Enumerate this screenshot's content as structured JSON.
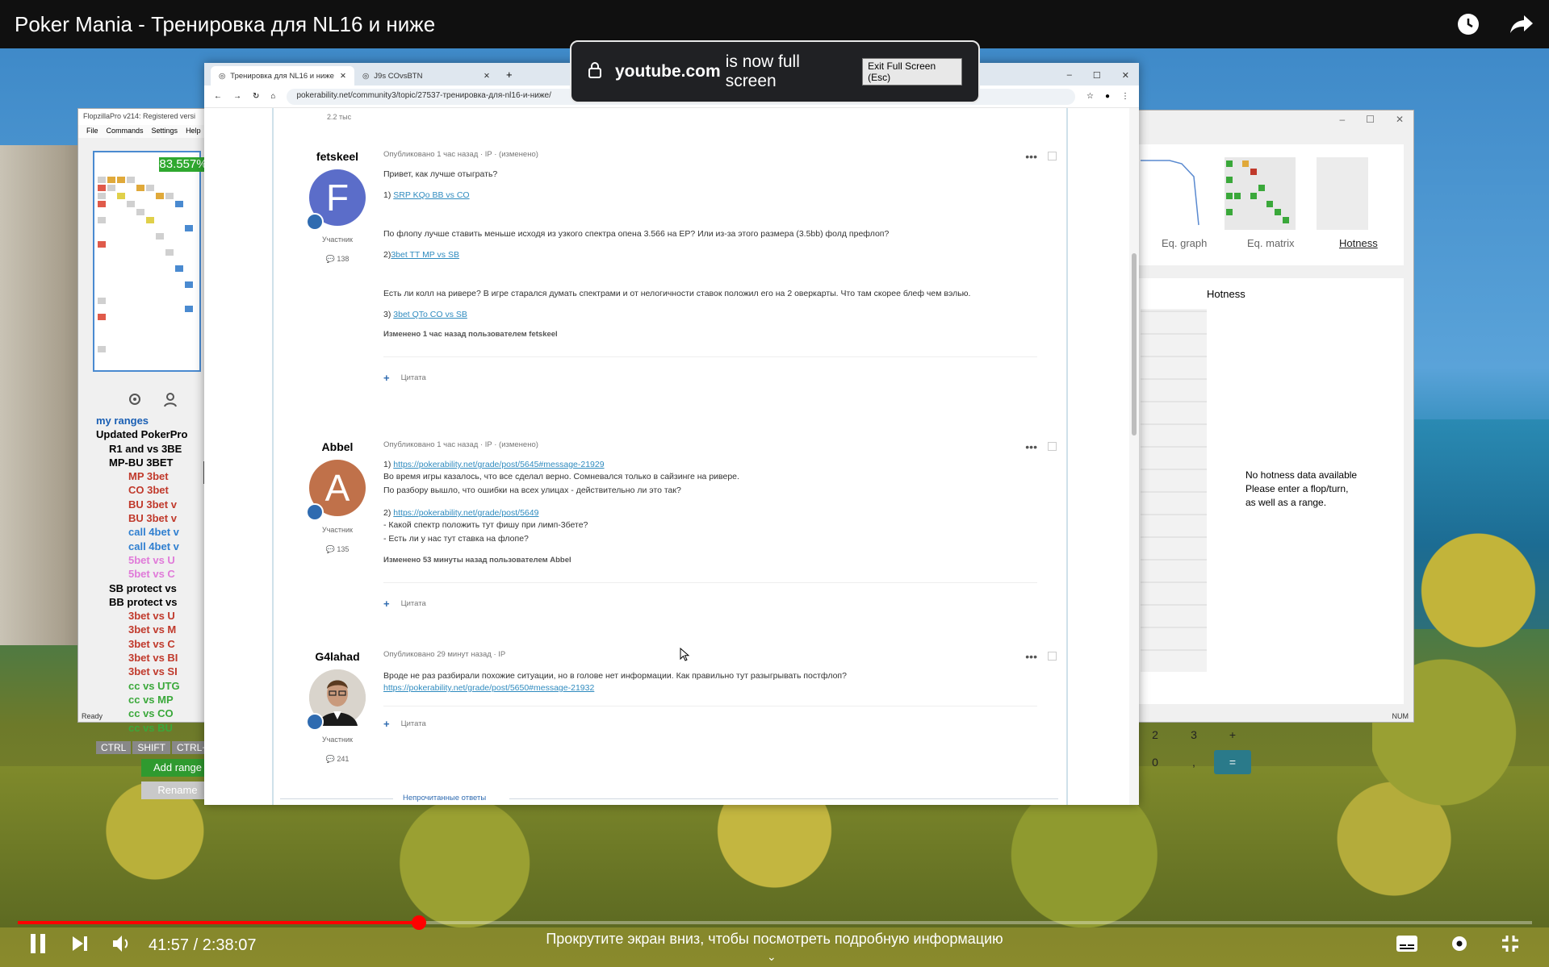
{
  "video": {
    "title": "Poker Mania - Тренировка для NL16 и ниже",
    "time_current": "41:57",
    "time_total": "2:38:07",
    "time_display": "41:57 / 2:38:07",
    "progress_fraction": 0.265,
    "scroll_hint": "Прокрутите экран вниз, чтобы посмотреть подробную информацию"
  },
  "toast": {
    "domain": "youtube.com",
    "message": "is now full screen",
    "exit_label": "Exit Full Screen (Esc)"
  },
  "flopzilla": {
    "title": "FlopzillaPro v214: Registered versi",
    "menu": [
      "File",
      "Commands",
      "Settings",
      "Help"
    ],
    "equity": "83.557%",
    "tree": [
      {
        "label": "my ranges",
        "color": "#1a5fb4"
      },
      {
        "label": "Updated PokerPro",
        "color": "#000"
      },
      {
        "label": "R1 and vs 3BE",
        "color": "#000"
      },
      {
        "label": "MP-BU 3BET",
        "color": "#000"
      },
      {
        "label": "MP 3bet",
        "color": "#c0392b"
      },
      {
        "label": "CO 3bet",
        "color": "#c0392b"
      },
      {
        "label": "BU 3bet v",
        "color": "#c0392b"
      },
      {
        "label": "BU 3bet v",
        "color": "#c0392b"
      },
      {
        "label": "call 4bet v",
        "color": "#2f7fd0"
      },
      {
        "label": "call 4bet v",
        "color": "#2f7fd0"
      },
      {
        "label": "5bet vs U",
        "color": "#e07ad9"
      },
      {
        "label": "5bet vs C",
        "color": "#e07ad9"
      },
      {
        "label": "SB protect vs",
        "color": "#000"
      },
      {
        "label": "BB protect vs",
        "color": "#000"
      },
      {
        "label": "3bet vs U",
        "color": "#c0392b"
      },
      {
        "label": "3bet vs M",
        "color": "#c0392b"
      },
      {
        "label": "3bet vs C",
        "color": "#c0392b"
      },
      {
        "label": "3bet vs BI",
        "color": "#c0392b"
      },
      {
        "label": "3bet vs SI",
        "color": "#c0392b"
      },
      {
        "label": "cc vs UTG",
        "color": "#3aa83a"
      },
      {
        "label": "cc vs MP",
        "color": "#3aa83a"
      },
      {
        "label": "cc vs CO",
        "color": "#3aa83a"
      },
      {
        "label": "cc vs BU",
        "color": "#3aa83a"
      }
    ],
    "keys": [
      "CTRL",
      "SHIFT",
      "CTRL+SH"
    ],
    "add_range": "Add range",
    "rename": "Rename",
    "status": "Ready"
  },
  "flopzilla_right": {
    "tabs": [
      "Eq. graph",
      "Eq. matrix",
      "Hotness"
    ],
    "hotness_title": "Hotness",
    "no_data": [
      "No hotness data available",
      "Please enter a flop/turn,",
      "as well as a range."
    ],
    "num": "NUM"
  },
  "calculator": {
    "keys": [
      "2",
      "3",
      "+",
      "0",
      ",",
      "="
    ]
  },
  "browser": {
    "tabs": [
      {
        "label": "Тренировка для NL16 и ниже"
      },
      {
        "label": "J9s COvsBTN"
      }
    ],
    "url": "pokerability.net/community3/topic/27537-тренировка-для-nl16-и-ниже/",
    "forum": {
      "top_count": "2.2 тыс",
      "posts": [
        {
          "author": "fetskeel",
          "avatar_letter": "F",
          "avatar_color": "#5b6dc9",
          "role": "Участник",
          "count": "138",
          "meta": "Опубликовано 1 час назад · IP · (изменено)",
          "greeting": "Привет, как лучше отыграть?",
          "link1_prefix": "1) ",
          "link1": "SRP KQo BB vs CO",
          "text1": "По флопу лучше ставить меньше исходя из узкого спектра опена 3.566 на EP? Или из-за этого размера (3.5bb) фолд префлоп?",
          "link2_prefix": "2)",
          "link2": "3bet TT MP vs SB",
          "text2": "Есть ли колл на ривере? В игре старался думать спектрами и от нелогичности ставок положил его на 2 оверкарты. Что там скорее блеф чем вэлью.",
          "link3_prefix": "3) ",
          "link3": "3bet QTo CO vs SB",
          "edited": "Изменено 1 час назад пользователем fetskeel",
          "quote": "Цитата"
        },
        {
          "author": "Abbel",
          "avatar_letter": "A",
          "avatar_color": "#c0714a",
          "role": "Участник",
          "count": "135",
          "meta": "Опубликовано 1 час назад · IP · (изменено)",
          "link1_prefix": "1) ",
          "link1": "https://pokerability.net/grade/post/5645#message-21929",
          "line1": "Во время игры казалось, что все сделал верно. Сомневался только в сайзинге на ривере.",
          "line2": "По разбору вышло, что ошибки на всех улицах - действительно ли это так?",
          "link2_prefix": "2) ",
          "link2": "https://pokerability.net/grade/post/5649",
          "line3": "- Какой спектр положить тут фишу при лимп-3бете?",
          "line4": "- Есть ли у нас тут ставка на флопе?",
          "edited": "Изменено 53 минуты назад пользователем Abbel",
          "quote": "Цитата"
        },
        {
          "author": "G4lahad",
          "role": "Участник",
          "count": "241",
          "meta": "Опубликовано 29 минут назад · IP",
          "text": "Вроде не раз разбирали похожие ситуации, но в голове нет информации. Как правильно тут разыгрывать постфлоп?",
          "link": "https://pokerability.net/grade/post/5650#message-21932",
          "quote": "Цитата"
        }
      ],
      "unread": "Непрочитанные ответы"
    }
  }
}
